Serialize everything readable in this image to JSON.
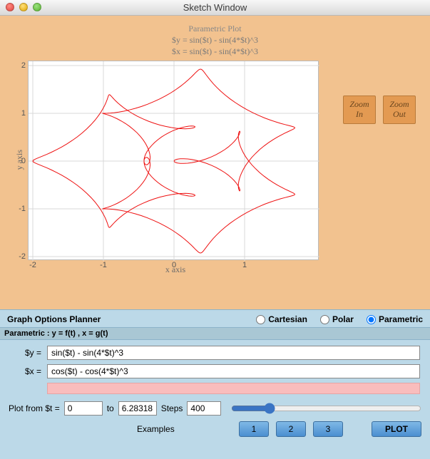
{
  "window": {
    "title": "Sketch Window"
  },
  "plot": {
    "header_main": "Parametric Plot",
    "header_line1": "$y = sin($t) - sin(4*$t)^3",
    "header_line2": "$x = sin($t) - sin(4*$t)^3",
    "x_axis_label": "x axis",
    "y_axis_label": "y axis"
  },
  "zoom": {
    "in": "Zoom\nIn",
    "out": "Zoom\nOut"
  },
  "chart_data": {
    "type": "line",
    "mode": "parametric",
    "t_range": [
      0,
      6.28318
    ],
    "steps": 400,
    "x_expr": "cos(t) - cos(4*t)^3",
    "y_expr": "sin(t) - sin(4*t)^3",
    "xlim": [
      -2,
      2
    ],
    "ylim": [
      -2,
      2
    ],
    "x_ticks": [
      -2,
      -1,
      0,
      1
    ],
    "y_ticks": [
      -2,
      -1,
      0,
      1,
      2
    ],
    "xlabel": "x axis",
    "ylabel": "y axis",
    "title": "Parametric Plot",
    "grid": true,
    "color": "#ee1111"
  },
  "options": {
    "panel_title": "Graph Options Planner",
    "modes": {
      "cartesian": "Cartesian",
      "polar": "Polar",
      "parametric": "Parametric"
    },
    "selected_mode": "parametric",
    "subheader": "Parametric : y = f(t) ,  x = g(t)",
    "y_label": "$y =",
    "y_value": "sin($t) - sin(4*$t)^3",
    "x_label": "$x =",
    "x_value": "cos($t) - cos(4*$t)^3",
    "plot_from_label": "Plot from $t =",
    "t_start": "0",
    "to_label": "to",
    "t_end": "6.28318",
    "steps_label": "Steps",
    "steps_value": "400",
    "examples_label": "Examples",
    "ex1": "1",
    "ex2": "2",
    "ex3": "3",
    "plot_button": "PLOT"
  }
}
